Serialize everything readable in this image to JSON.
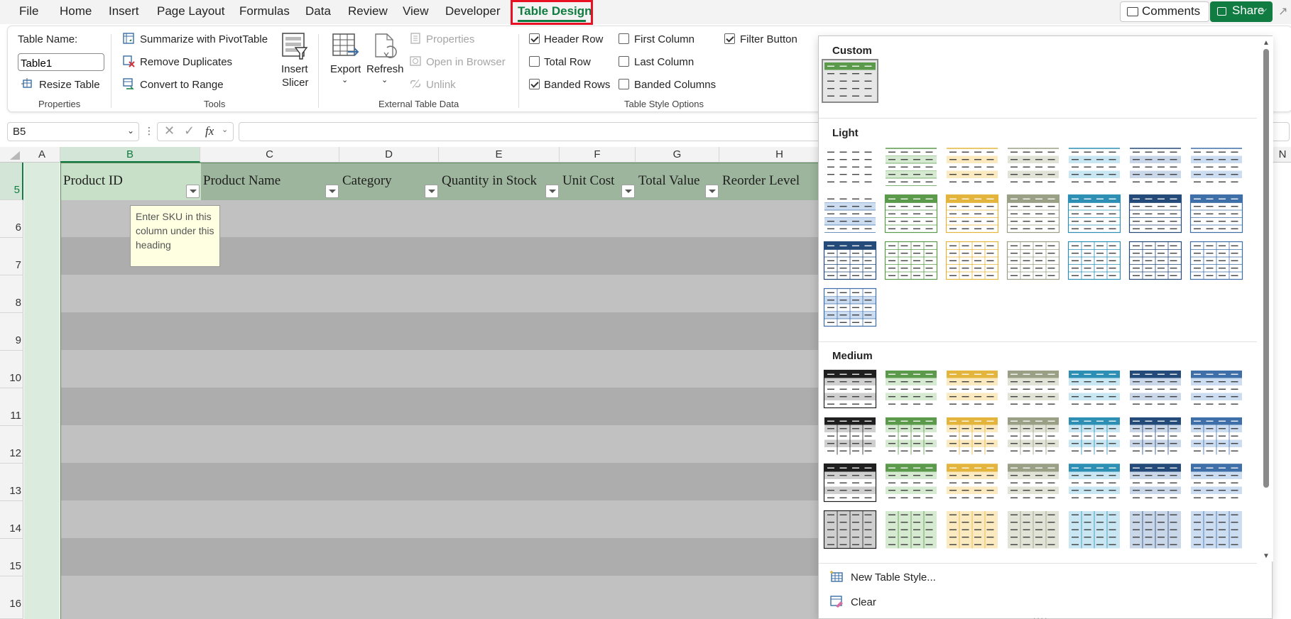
{
  "menu": {
    "tabs": [
      "File",
      "Home",
      "Insert",
      "Page Layout",
      "Formulas",
      "Data",
      "Review",
      "View",
      "Developer",
      "Table Design"
    ],
    "active_tab": "Table Design",
    "comments_label": "Comments",
    "share_label": "Share"
  },
  "ribbon": {
    "properties": {
      "table_name_label": "Table Name:",
      "table_name_value": "Table1",
      "resize_label": "Resize Table",
      "group_label": "Properties"
    },
    "tools": {
      "summarize_label": "Summarize with PivotTable",
      "remove_dup_label": "Remove Duplicates",
      "convert_label": "Convert to Range",
      "insert_slicer_line1": "Insert",
      "insert_slicer_line2": "Slicer",
      "group_label": "Tools"
    },
    "external": {
      "export_label": "Export",
      "refresh_label": "Refresh",
      "properties_label": "Properties",
      "open_browser_label": "Open in Browser",
      "unlink_label": "Unlink",
      "group_label": "External Table Data"
    },
    "style_options": {
      "header_row": {
        "label": "Header Row",
        "checked": true
      },
      "total_row": {
        "label": "Total Row",
        "checked": false
      },
      "banded_rows": {
        "label": "Banded Rows",
        "checked": true
      },
      "first_column": {
        "label": "First Column",
        "checked": false
      },
      "last_column": {
        "label": "Last Column",
        "checked": false
      },
      "banded_columns": {
        "label": "Banded Columns",
        "checked": false
      },
      "filter_button": {
        "label": "Filter Button",
        "checked": true
      },
      "group_label": "Table Style Options"
    }
  },
  "formula_bar": {
    "name_box": "B5",
    "fx_label": "fx",
    "value": ""
  },
  "grid": {
    "column_headers": [
      "A",
      "B",
      "C",
      "D",
      "E",
      "F",
      "G",
      "H",
      "N"
    ],
    "selected_column": "B",
    "row_headers": [
      "5",
      "6",
      "7",
      "8",
      "9",
      "10",
      "11",
      "12",
      "13",
      "14",
      "15",
      "16"
    ],
    "selected_row": "5",
    "table_headers": [
      "Product ID",
      "Product Name",
      "Category",
      "Quantity in Stock",
      "Unit Cost",
      "Total Value",
      "Reorder Level"
    ],
    "tooltip": "Enter SKU in this column under this heading"
  },
  "gallery": {
    "sections": [
      "Custom",
      "Light",
      "Medium"
    ],
    "new_style_label": "New Table Style...",
    "clear_label": "Clear",
    "grip": "....",
    "colors": {
      "black": "#1f1f1f",
      "green": "#5a9a4a",
      "gold": "#e4b53c",
      "olive": "#9aa086",
      "teal": "#2e8fb4",
      "navy": "#234a78",
      "blue": "#3f6fa8"
    }
  },
  "colors": {
    "accent": "#107c41",
    "highlight_frame": "#e81123",
    "table_header": "#9cb59c",
    "band_a": "#c1c1c1",
    "band_b": "#adadad"
  }
}
